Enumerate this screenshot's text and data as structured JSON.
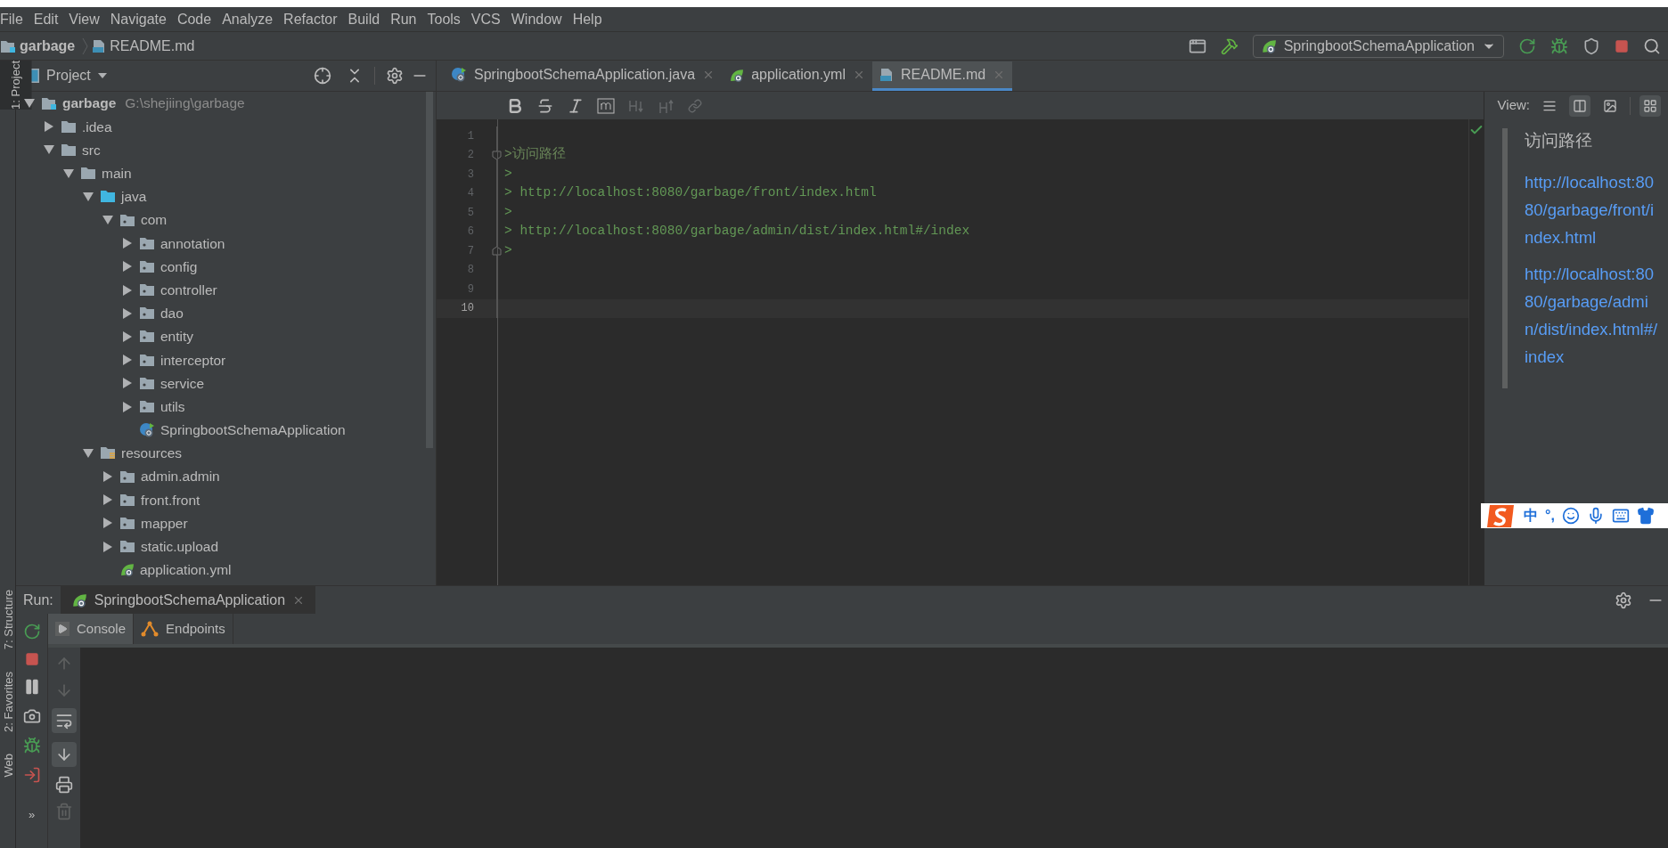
{
  "menu": [
    {
      "label": "File"
    },
    {
      "label": "Edit"
    },
    {
      "label": "View"
    },
    {
      "label": "Navigate"
    },
    {
      "label": "Code"
    },
    {
      "label": "Analyze"
    },
    {
      "label": "Refactor"
    },
    {
      "label": "Build"
    },
    {
      "label": "Run"
    },
    {
      "label": "Tools"
    },
    {
      "label": "VCS"
    },
    {
      "label": "Window"
    },
    {
      "label": "Help"
    }
  ],
  "breadcrumb": [
    {
      "label": "garbage",
      "kind": "module"
    },
    {
      "label": "README.md",
      "kind": "markdown"
    }
  ],
  "run_config": "SpringbootSchemaApplication",
  "side_stripe_top": [
    {
      "label": "1: Project",
      "selected": true
    }
  ],
  "side_stripe_bottom": [
    {
      "label": "7: Structure"
    },
    {
      "label": "2: Favorites"
    },
    {
      "label": "Web"
    }
  ],
  "project_panel": {
    "title": "Project",
    "tree": [
      {
        "label": "garbage",
        "path": "G:\\shejiing\\garbage",
        "kind": "module",
        "expanded": true,
        "children": [
          {
            "label": ".idea",
            "kind": "folder",
            "expanded": false
          },
          {
            "label": "src",
            "kind": "folder",
            "expanded": true,
            "children": [
              {
                "label": "main",
                "kind": "folder",
                "expanded": true,
                "children": [
                  {
                    "label": "java",
                    "kind": "source",
                    "expanded": true,
                    "children": [
                      {
                        "label": "com",
                        "kind": "package",
                        "expanded": true,
                        "children": [
                          {
                            "label": "annotation",
                            "kind": "package",
                            "expanded": false
                          },
                          {
                            "label": "config",
                            "kind": "package",
                            "expanded": false
                          },
                          {
                            "label": "controller",
                            "kind": "package",
                            "expanded": false
                          },
                          {
                            "label": "dao",
                            "kind": "package",
                            "expanded": false
                          },
                          {
                            "label": "entity",
                            "kind": "package",
                            "expanded": false
                          },
                          {
                            "label": "interceptor",
                            "kind": "package",
                            "expanded": false
                          },
                          {
                            "label": "service",
                            "kind": "package",
                            "expanded": false
                          },
                          {
                            "label": "utils",
                            "kind": "package",
                            "expanded": false
                          },
                          {
                            "label": "SpringbootSchemaApplication",
                            "kind": "spring"
                          }
                        ]
                      }
                    ]
                  },
                  {
                    "label": "resources",
                    "kind": "resources",
                    "expanded": true,
                    "children": [
                      {
                        "label": "admin.admin",
                        "kind": "package",
                        "expanded": false
                      },
                      {
                        "label": "front.front",
                        "kind": "package",
                        "expanded": false
                      },
                      {
                        "label": "mapper",
                        "kind": "package",
                        "expanded": false
                      },
                      {
                        "label": "static.upload",
                        "kind": "package",
                        "expanded": false
                      },
                      {
                        "label": "application.yml",
                        "kind": "yaml"
                      }
                    ]
                  }
                ]
              }
            ]
          }
        ]
      }
    ]
  },
  "tabs": [
    {
      "label": "SpringbootSchemaApplication.java",
      "kind": "spring",
      "selected": false
    },
    {
      "label": "application.yml",
      "kind": "yaml",
      "selected": false
    },
    {
      "label": "README.md",
      "kind": "markdown",
      "selected": true
    }
  ],
  "view_label": "View:",
  "view_modes": [
    {
      "kind": "editor",
      "selected": false
    },
    {
      "kind": "split",
      "selected": true
    },
    {
      "kind": "preview",
      "selected": false
    }
  ],
  "scroll_sync": {
    "on": true
  },
  "lines": [
    {
      "number": "1",
      "current": false,
      "fold_start": false,
      "fold_end": false
    },
    {
      "number": "2",
      "text": ">访问路径",
      "kind": "heading",
      "fold_start": true,
      "fold_end": false,
      "current": false
    },
    {
      "number": "3",
      "text": ">",
      "kind": "quote",
      "current": false,
      "fold_start": false,
      "fold_end": false
    },
    {
      "number": "4",
      "text": "> http://localhost:8080/garbage/front/index.html",
      "kind": "quote",
      "current": false,
      "fold_start": false,
      "fold_end": false
    },
    {
      "number": "5",
      "text": ">",
      "kind": "quote",
      "current": false,
      "fold_start": false,
      "fold_end": false
    },
    {
      "number": "6",
      "text": "> http://localhost:8080/garbage/admin/dist/index.html#/index",
      "kind": "quote",
      "current": false,
      "fold_start": false,
      "fold_end": false
    },
    {
      "number": "7",
      "text": ">",
      "kind": "quote",
      "fold_start": false,
      "fold_end": true,
      "current": false
    },
    {
      "number": "8",
      "current": false,
      "fold_start": false,
      "fold_end": false
    },
    {
      "number": "9",
      "current": false,
      "fold_start": false,
      "fold_end": false
    },
    {
      "number": "10",
      "current": true,
      "fold_start": false,
      "fold_end": false
    }
  ],
  "preview": {
    "heading": "访问路径",
    "links": [
      "http://localhost:8080/garbage/front/index.html",
      "http://localhost:8080/garbage/admin/dist/index.html#/index"
    ]
  },
  "ime_toolbar": {
    "mode": "中",
    "punctuation": "°,"
  },
  "run_panel": {
    "label": "Run:",
    "tab": "SpringbootSchemaApplication",
    "subtabs": [
      {
        "label": "Console",
        "kind": "console",
        "selected": true
      },
      {
        "label": "Endpoints",
        "kind": "endpoints",
        "selected": false
      }
    ],
    "more": "»"
  }
}
